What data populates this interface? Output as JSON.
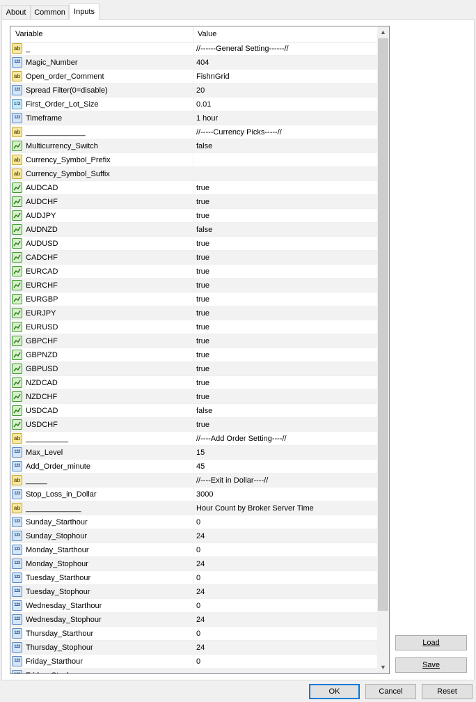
{
  "tabs": [
    {
      "label": "About"
    },
    {
      "label": "Common"
    },
    {
      "label": "Inputs"
    }
  ],
  "grid": {
    "headers": {
      "variable": "Variable",
      "value": "Value"
    },
    "rows": [
      {
        "type": "str",
        "variable": "_",
        "value": "//------General Setting------//"
      },
      {
        "type": "int",
        "variable": "Magic_Number",
        "value": "404"
      },
      {
        "type": "str",
        "variable": "Open_order_Comment",
        "value": "FishnGrid"
      },
      {
        "type": "int",
        "variable": "Spread Filter(0=disable)",
        "value": "20"
      },
      {
        "type": "dbl",
        "variable": "First_Order_Lot_Size",
        "value": "0.01"
      },
      {
        "type": "int",
        "variable": "Timeframe",
        "value": "1 hour"
      },
      {
        "type": "str",
        "variable": "______________",
        "value": "//-----Currency Picks-----//"
      },
      {
        "type": "bool",
        "variable": "Multicurrency_Switch",
        "value": "false"
      },
      {
        "type": "str",
        "variable": "Currency_Symbol_Prefix",
        "value": ""
      },
      {
        "type": "str",
        "variable": "Currency_Symbol_Suffix",
        "value": ""
      },
      {
        "type": "bool",
        "variable": "AUDCAD",
        "value": "true"
      },
      {
        "type": "bool",
        "variable": "AUDCHF",
        "value": "true"
      },
      {
        "type": "bool",
        "variable": "AUDJPY",
        "value": "true"
      },
      {
        "type": "bool",
        "variable": "AUDNZD",
        "value": "false"
      },
      {
        "type": "bool",
        "variable": "AUDUSD",
        "value": "true"
      },
      {
        "type": "bool",
        "variable": "CADCHF",
        "value": "true"
      },
      {
        "type": "bool",
        "variable": "EURCAD",
        "value": "true"
      },
      {
        "type": "bool",
        "variable": "EURCHF",
        "value": "true"
      },
      {
        "type": "bool",
        "variable": "EURGBP",
        "value": "true"
      },
      {
        "type": "bool",
        "variable": "EURJPY",
        "value": "true"
      },
      {
        "type": "bool",
        "variable": "EURUSD",
        "value": "true"
      },
      {
        "type": "bool",
        "variable": "GBPCHF",
        "value": "true"
      },
      {
        "type": "bool",
        "variable": "GBPNZD",
        "value": "true"
      },
      {
        "type": "bool",
        "variable": "GBPUSD",
        "value": "true"
      },
      {
        "type": "bool",
        "variable": "NZDCAD",
        "value": "true"
      },
      {
        "type": "bool",
        "variable": "NZDCHF",
        "value": "true"
      },
      {
        "type": "bool",
        "variable": "USDCAD",
        "value": "false"
      },
      {
        "type": "bool",
        "variable": "USDCHF",
        "value": "true"
      },
      {
        "type": "str",
        "variable": "__________",
        "value": "//----Add Order Setting----//"
      },
      {
        "type": "int",
        "variable": "Max_Level",
        "value": "15"
      },
      {
        "type": "int",
        "variable": "Add_Order_minute",
        "value": "45"
      },
      {
        "type": "str",
        "variable": "_____",
        "value": "//----Exit in Dollar----//"
      },
      {
        "type": "int",
        "variable": "Stop_Loss_in_Dollar",
        "value": "3000"
      },
      {
        "type": "str",
        "variable": "_____________",
        "value": "Hour Count by Broker Server Time"
      },
      {
        "type": "int",
        "variable": "Sunday_Starthour",
        "value": "0"
      },
      {
        "type": "int",
        "variable": "Sunday_Stophour",
        "value": "24"
      },
      {
        "type": "int",
        "variable": "Monday_Starthour",
        "value": "0"
      },
      {
        "type": "int",
        "variable": "Monday_Stophour",
        "value": "24"
      },
      {
        "type": "int",
        "variable": "Tuesday_Starthour",
        "value": "0"
      },
      {
        "type": "int",
        "variable": "Tuesday_Stophour",
        "value": "24"
      },
      {
        "type": "int",
        "variable": "Wednesday_Starthour",
        "value": "0"
      },
      {
        "type": "int",
        "variable": "Wednesday_Stophour",
        "value": "24"
      },
      {
        "type": "int",
        "variable": "Thursday_Starthour",
        "value": "0"
      },
      {
        "type": "int",
        "variable": "Thursday_Stophour",
        "value": "24"
      },
      {
        "type": "int",
        "variable": "Friday_Starthour",
        "value": "0"
      },
      {
        "type": "int",
        "variable": "Friday_Stophour",
        "value": ""
      }
    ]
  },
  "icons": {
    "str": "ab",
    "int": "123",
    "dbl": "1/2",
    "bool": "bool-chart"
  },
  "side_buttons": {
    "load_label": "Load",
    "save_label": "Save"
  },
  "footer_buttons": {
    "ok_label": "OK",
    "cancel_label": "Cancel",
    "reset_label": "Reset"
  },
  "colors": {
    "accent": "#0078d7",
    "alt_row": "#f2f2f2"
  }
}
